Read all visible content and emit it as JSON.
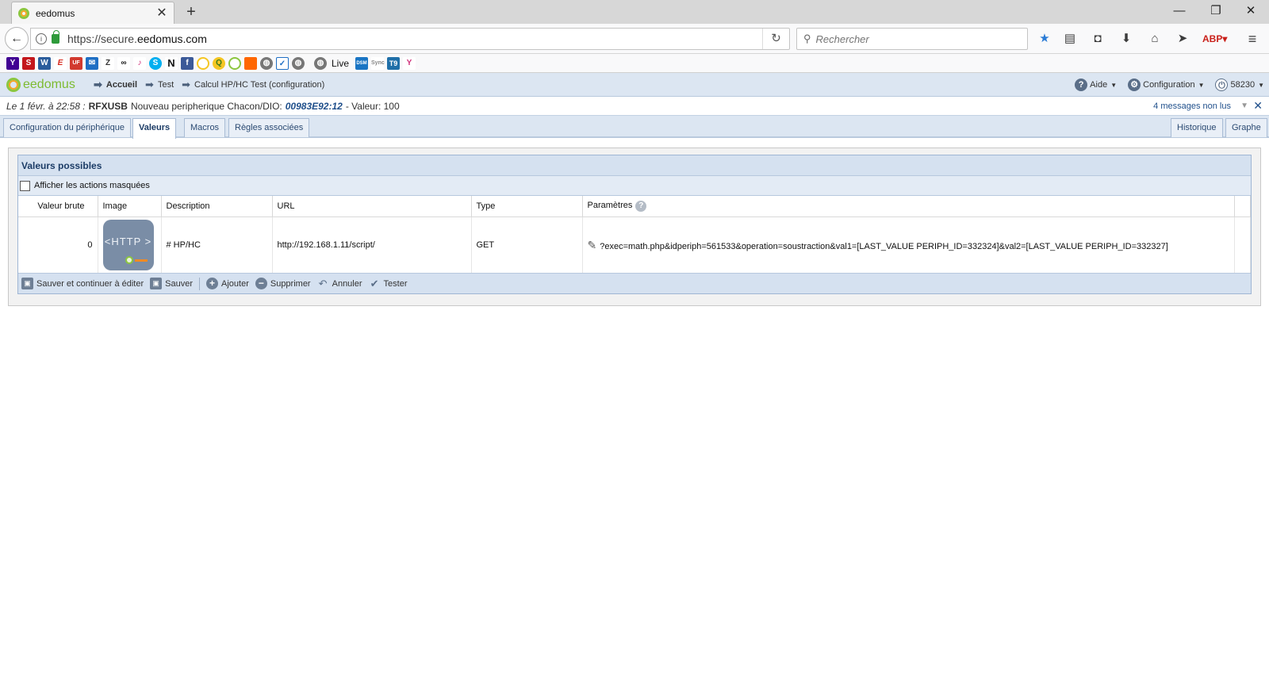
{
  "browser": {
    "tab_title": "eedomus",
    "url_prefix": "https://secure.",
    "url_domain": "eedomus.com",
    "search_placeholder": "Rechercher",
    "bookmark_live": "Live",
    "bookmarks": [
      "Y",
      "S",
      "W",
      "E",
      "UF",
      "M",
      "Z",
      "TA",
      "♪",
      "S",
      "N",
      "f",
      "O",
      "Q",
      "O",
      "Or",
      "W",
      "✓",
      "W",
      "Live",
      "DSM",
      "Sync",
      "T9",
      "Y"
    ]
  },
  "app": {
    "logo": "eedomus",
    "breadcrumb": [
      "Accueil",
      "Test",
      "Calcul HP/HC Test (configuration)"
    ],
    "help_label": "Aide",
    "config_label": "Configuration",
    "user_id": "58230"
  },
  "notification": {
    "date": "Le 1 févr. à 22:58 :",
    "device": "RFXUSB",
    "text": "Nouveau peripherique Chacon/DIO:",
    "code": "00983E92:12",
    "value": "- Valeur: 100",
    "unread": "4 messages non lus"
  },
  "tabs": {
    "config": "Configuration du périphérique",
    "values": "Valeurs",
    "macros": "Macros",
    "rules": "Règles associées",
    "history": "Historique",
    "graph": "Graphe"
  },
  "panel": {
    "title": "Valeurs possibles",
    "show_masked": "Afficher les actions masquées",
    "columns": [
      "Valeur brute",
      "Image",
      "Description",
      "URL",
      "Type",
      "Paramètres"
    ],
    "row": {
      "raw_value": "0",
      "image_label": "<HTTP >",
      "description": "# HP/HC",
      "url": "http://192.168.1.11/script/",
      "type": "GET",
      "params": "?exec=math.php&idperiph=561533&operation=soustraction&val1=[LAST_VALUE PERIPH_ID=332324]&val2=[LAST_VALUE PERIPH_ID=332327]"
    },
    "actions": {
      "save_continue": "Sauver et continuer à éditer",
      "save": "Sauver",
      "add": "Ajouter",
      "delete": "Supprimer",
      "cancel": "Annuler",
      "test": "Tester"
    }
  },
  "colors": {
    "accent_blue": "#1f4f8b",
    "header_bg": "#dce6f2",
    "logo_green": "#8cc63f",
    "logo_orange": "#f5a623"
  }
}
